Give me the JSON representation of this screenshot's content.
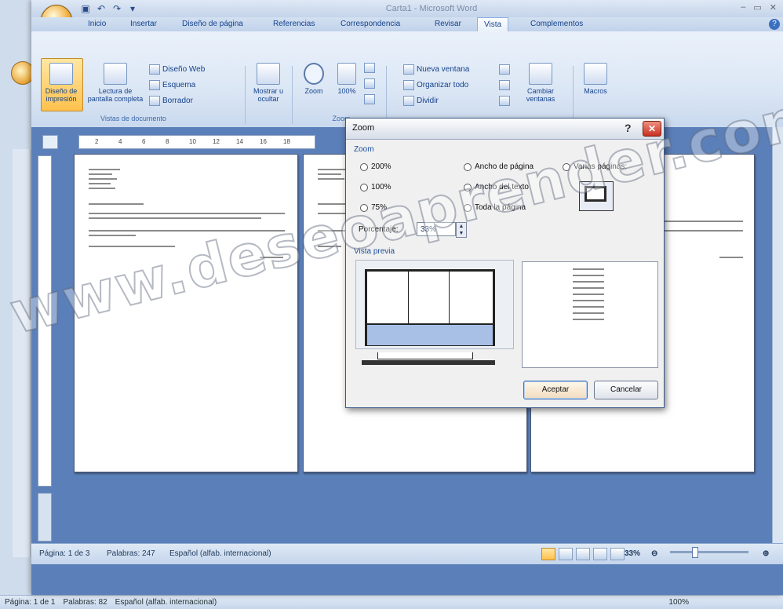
{
  "window": {
    "title": "Carta1 - Microsoft Word",
    "controls": [
      "–",
      "▭",
      "✕"
    ]
  },
  "quick_access": [
    "save-icon",
    "undo-icon",
    "redo-icon",
    "customize-icon"
  ],
  "tabs": [
    "Inicio",
    "Insertar",
    "Diseño de página",
    "Referencias",
    "Correspondencia",
    "Revisar",
    "Vista",
    "Complementos"
  ],
  "active_tab": "Vista",
  "ribbon": {
    "vistas_doc": {
      "label": "Vistas de documento",
      "print_layout": "Diseño de impresión",
      "full_screen": "Lectura de pantalla completa",
      "web": "Diseño Web",
      "outline": "Esquema",
      "draft": "Borrador"
    },
    "show_hide": "Mostrar u ocultar",
    "zoom_group": {
      "label": "Zoom",
      "zoom": "Zoom",
      "hundred": "100%"
    },
    "window_group": {
      "new_window": "Nueva ventana",
      "arrange_all": "Organizar todo",
      "split": "Dividir",
      "switch_windows": "Cambiar ventanas",
      "macros": "Macros"
    }
  },
  "ruler_ticks": [
    "2",
    "4",
    "6",
    "8",
    "10",
    "12",
    "14",
    "16",
    "18"
  ],
  "status": {
    "page": "Página: 1 de 3",
    "words": "Palabras: 247",
    "language": "Español (alfab. internacional)",
    "zoom": "33%"
  },
  "back_status": {
    "page": "Página: 1 de 1",
    "words": "Palabras: 82",
    "language": "Español (alfab. internacional)",
    "zoom": "100%"
  },
  "dialog": {
    "title": "Zoom",
    "zoom_section": "Zoom",
    "options_left": [
      "200%",
      "100%",
      "75%"
    ],
    "options_mid": [
      "Ancho de página",
      "Ancho del texto",
      "Toda la página"
    ],
    "option_multi": "Varias páginas:",
    "percent_label": "Porcentaje:",
    "percent_value": "33%",
    "preview_label": "Vista previa",
    "ok": "Aceptar",
    "cancel": "Cancelar"
  },
  "watermark": "www.deseoaprender.com",
  "colors": {
    "doc_background": "#5b7fb8",
    "ribbon": "#dce7f5",
    "selected_button": "#ffc14d"
  }
}
